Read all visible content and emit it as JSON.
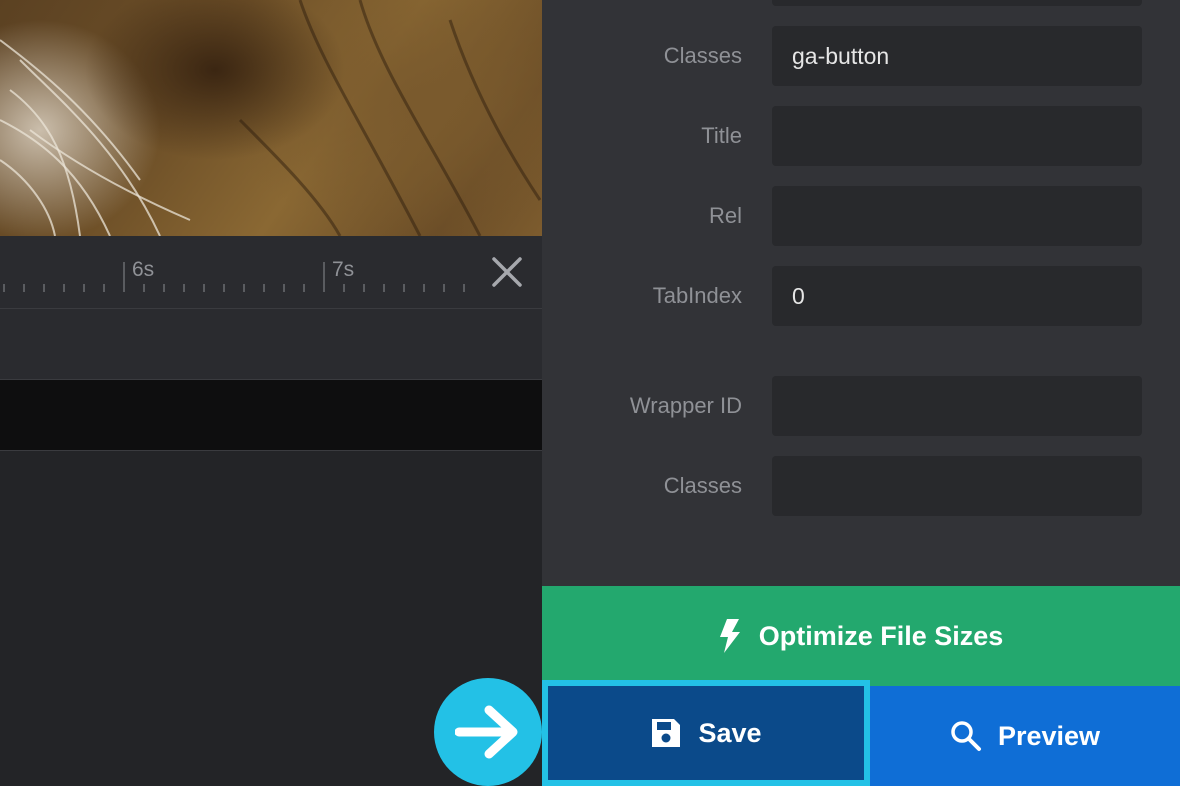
{
  "timeline": {
    "ticks": [
      "6s",
      "7s"
    ]
  },
  "panel": {
    "fields": [
      {
        "label": "Classes",
        "value": "ga-button",
        "placeholder": ""
      },
      {
        "label": "Title",
        "value": "",
        "placeholder": ""
      },
      {
        "label": "Rel",
        "value": "",
        "placeholder": ""
      },
      {
        "label": "TabIndex",
        "value": "0",
        "placeholder": ""
      },
      {
        "label": "Wrapper ID",
        "value": "",
        "placeholder": ""
      },
      {
        "label": "Classes",
        "value": "",
        "placeholder": ""
      }
    ]
  },
  "buttons": {
    "optimize_label": "Optimize File Sizes",
    "save_label": "Save",
    "preview_label": "Preview"
  },
  "icons": {
    "optimize": "lightning-icon",
    "save": "floppy-disk-icon",
    "preview": "search-icon",
    "close": "close-icon",
    "indicator": "arrow-right-icon"
  },
  "colors": {
    "optimize_bg": "#23a86e",
    "save_bg": "#0b4a8a",
    "save_highlight": "#23c1e6",
    "preview_bg": "#0f6ed6",
    "panel_bg": "#323337"
  }
}
